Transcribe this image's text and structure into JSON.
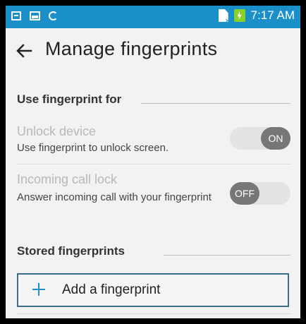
{
  "status_bar": {
    "time": "7:17 AM",
    "left_icons": [
      "message-icon",
      "image-icon",
      "sync-icon"
    ],
    "right_icons": [
      "sim-missing-icon",
      "battery-charging-icon"
    ],
    "bg_color": "#1b8fc8"
  },
  "appbar": {
    "title": "Manage fingerprints",
    "back_icon": "back-arrow-icon"
  },
  "sections": {
    "use_for": "Use fingerprint for",
    "stored": "Stored fingerprints"
  },
  "settings": [
    {
      "title": "Unlock device",
      "desc": "Use fingerprint to unlock screen.",
      "toggle": "ON"
    },
    {
      "title": "Incoming call lock",
      "desc": "Answer incoming call with your fingerprint",
      "toggle": "OFF"
    }
  ],
  "add_button": {
    "label": "Add a fingerprint",
    "icon": "plus-icon",
    "accent": "#1b8fc8"
  }
}
